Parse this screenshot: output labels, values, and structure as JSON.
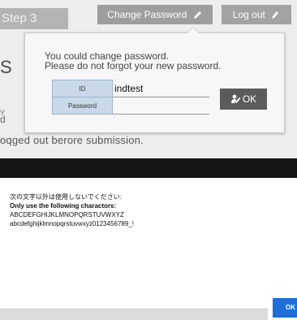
{
  "header": {
    "step_label": "Step 3",
    "change_password_label": "Change Password",
    "logout_label": "Log out"
  },
  "background": {
    "fragment_s": "S",
    "fragment_y": "Y",
    "fragment_d": "d",
    "fragment_logged": "oqged out berore submission."
  },
  "popover": {
    "message_line1": "You could change password.",
    "message_line2": "Please do not forgot your new password.",
    "id_label": "ID",
    "id_value": "indtest",
    "password_label": "Password",
    "password_value": "",
    "ok_label": "OK"
  },
  "dialog": {
    "rule_jp": "次の文字以外は使用しないでください:",
    "rule_en": "Only use the following charactors:",
    "chars_upper": "ABCDEFGHIJKLMNOPQRSTUVWXYZ",
    "chars_lower": "abcdefghijklmnopqrstuvwxyz0123456789_!",
    "ok_label": "OK"
  },
  "colors": {
    "accent": "#1f6fd6",
    "dark_header": "#141414",
    "label_cell": "#c9d9ea"
  }
}
